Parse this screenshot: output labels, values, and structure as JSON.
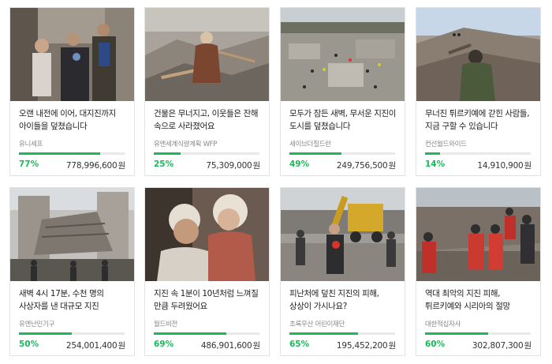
{
  "accent_color": "#1cb85a",
  "currency_unit": "원",
  "cards": [
    {
      "title": "오랜 내전에 이어, 대지진까지 아이들을 덮쳤습니다",
      "org": "유니세프",
      "percent": "77%",
      "progress": 0.77,
      "amount": "778,996,600",
      "image": "people-in-street"
    },
    {
      "title": "건물은 무너지고, 이웃들은 잔해 속으로 사라졌어요",
      "org": "유엔세계식량계획 WFP",
      "percent": "25%",
      "progress": 0.25,
      "amount": "75,309,000",
      "image": "woman-on-rubble"
    },
    {
      "title": "모두가 잠든 새벽, 무서운 지진이 도시를 덮쳤습니다",
      "org": "세이브더칠드런",
      "percent": "49%",
      "progress": 0.49,
      "amount": "249,756,500",
      "image": "aerial-collapsed-buildings"
    },
    {
      "title": "무너진 튀르키예에 갇힌 사람들, 지금 구할 수 있습니다",
      "org": "컨선월드와이드",
      "percent": "14%",
      "progress": 0.14,
      "amount": "14,910,900",
      "image": "rescuers-on-debris"
    },
    {
      "title": "새벽 4시 17분, 수천 명의 사상자를 낸 대규모 지진",
      "org": "유엔난민기구",
      "percent": "50%",
      "progress": 0.5,
      "amount": "254,001,400",
      "image": "collapsed-apartment"
    },
    {
      "title": "지진 속 1분이 10년처럼 느껴질 만큼 두려웠어요",
      "org": "월드비전",
      "percent": "69%",
      "progress": 0.69,
      "amount": "486,901,600",
      "image": "man-holding-child"
    },
    {
      "title": "피난처에 덮친 지진의 피해, 상상이 가시나요?",
      "org": "초록우산 어린이재단",
      "percent": "65%",
      "progress": 0.65,
      "amount": "195,452,200",
      "image": "excavator-crowd"
    },
    {
      "title": "역대 최악의 지진 피해, 튀르키예와 시리아의 절망",
      "org": "대한적십자사",
      "percent": "60%",
      "progress": 0.6,
      "amount": "302,807,300",
      "image": "red-crescent-workers"
    }
  ]
}
